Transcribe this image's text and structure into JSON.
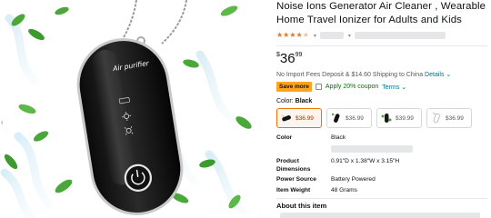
{
  "product": {
    "title_line1": "Noise Ions Generator Air Cleaner , Wearable",
    "title_line2": "Home Travel Ionizer for Adults and Kids",
    "rating_stars": 3.5,
    "device_brand_text": "Air purifier"
  },
  "price": {
    "symbol": "$",
    "whole": "36",
    "fraction": "99"
  },
  "shipping": {
    "text": "No Import Fees Deposit & $14.60 Shipping to China",
    "details_link": "Details"
  },
  "coupon": {
    "badge": "Save more",
    "text": "Apply 20% coupon",
    "terms_link": "Terms"
  },
  "color": {
    "label": "Color:",
    "selected": "Black",
    "options": [
      {
        "price": "$36.99",
        "selected": true,
        "tone": "black"
      },
      {
        "price": "$36.99",
        "selected": false,
        "tone": "black"
      },
      {
        "price": "$39.99",
        "selected": false,
        "tone": "green"
      },
      {
        "price": "$36.99",
        "selected": false,
        "tone": "white"
      }
    ]
  },
  "specs": [
    {
      "key": "Color",
      "value": "Black"
    },
    {
      "key": "Product Dimensions",
      "value": "0.91\"D x 1.38\"W x 3.15\"H"
    },
    {
      "key": "Power Source",
      "value": "Battery Powered"
    },
    {
      "key": "Item Weight",
      "value": "48 Grams"
    }
  ],
  "about": {
    "heading": "About this item"
  },
  "colors": {
    "star": "#de7921",
    "link": "#007185",
    "coupon_green": "#007600",
    "price_red": "#b12704",
    "badge": "#ffa41c",
    "selected_border": "#e77600"
  }
}
